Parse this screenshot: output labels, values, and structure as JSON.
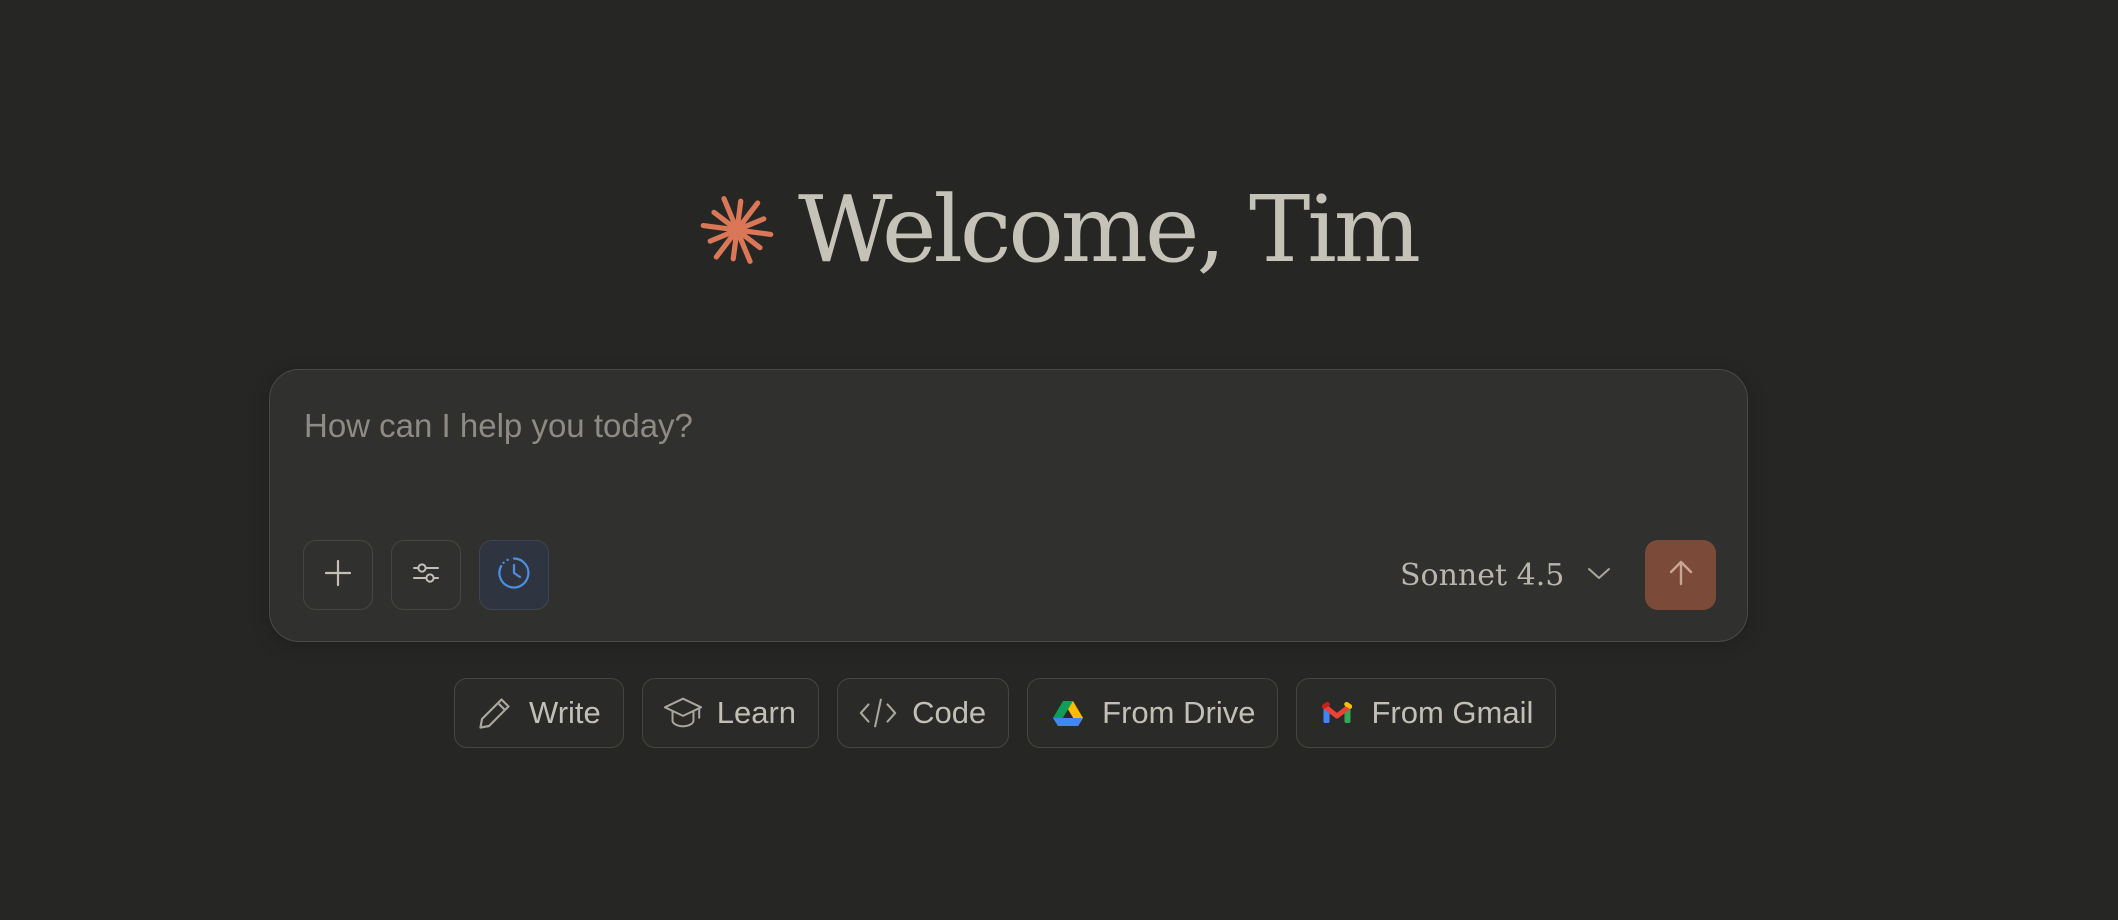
{
  "greeting": {
    "title": "Welcome, Tim",
    "logo_icon": "sparkle-burst-icon",
    "logo_color": "#d97757"
  },
  "composer": {
    "placeholder": "How can I help you today?",
    "tools": [
      {
        "name": "add-button",
        "icon": "plus-icon"
      },
      {
        "name": "settings-button",
        "icon": "sliders-icon"
      },
      {
        "name": "extended-thinking-button",
        "icon": "clock-icon",
        "active": true
      }
    ],
    "model": {
      "label": "Sonnet 4.5",
      "icon": "chevron-down-icon"
    },
    "send": {
      "icon": "arrow-up-icon",
      "color": "#7c4a38"
    }
  },
  "suggestions": [
    {
      "label": "Write",
      "icon": "pencil-icon"
    },
    {
      "label": "Learn",
      "icon": "graduation-cap-icon"
    },
    {
      "label": "Code",
      "icon": "code-icon"
    },
    {
      "label": "From Drive",
      "icon": "google-drive-icon"
    },
    {
      "label": "From Gmail",
      "icon": "gmail-icon"
    }
  ],
  "colors": {
    "background": "#262624",
    "composer_background": "#30302e",
    "text": "#c2c0b6",
    "placeholder": "#8d8b84",
    "accent_blue": "#4a8fe0"
  }
}
